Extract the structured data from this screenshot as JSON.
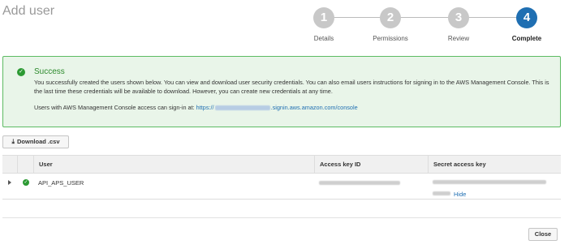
{
  "page": {
    "title": "Add user"
  },
  "steps": [
    {
      "number": "1",
      "label": "Details",
      "active": false
    },
    {
      "number": "2",
      "label": "Permissions",
      "active": false
    },
    {
      "number": "3",
      "label": "Review",
      "active": false
    },
    {
      "number": "4",
      "label": "Complete",
      "active": true
    }
  ],
  "alert": {
    "title": "Success",
    "icon": "check-circle-icon",
    "message": "You successfully created the users shown below. You can view and download user security credentials. You can also email users instructions for signing in to the AWS Management Console. This is the last time these credentials will be available to download. However, you can create new credentials at any time.",
    "signin_prefix": "Users with AWS Management Console access can sign-in at: ",
    "signin_link_start": "https://",
    "signin_link_end": ".signin.aws.amazon.com/console"
  },
  "toolbar": {
    "download_label": "Download .csv",
    "download_icon": "download-icon"
  },
  "table": {
    "columns": [
      "User",
      "Access key ID",
      "Secret access key"
    ],
    "rows": [
      {
        "user": "API_APS_USER",
        "status_icon": "check-circle-icon",
        "hide_label": "Hide"
      }
    ]
  },
  "footer": {
    "close_label": "Close"
  },
  "colors": {
    "accent": "#1f6fb2",
    "success": "#2c9a33",
    "success_bg": "#e9f5e9"
  }
}
